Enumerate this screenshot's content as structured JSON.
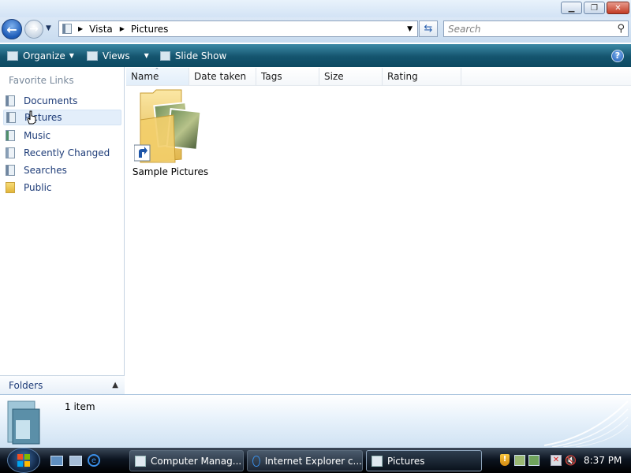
{
  "window": {
    "minimize_glyph": "▁",
    "maximize_glyph": "❐",
    "close_glyph": "✕"
  },
  "address": {
    "segments": [
      "Vista",
      "Pictures"
    ],
    "search_placeholder": "Search"
  },
  "toolbar": {
    "organize_label": "Organize",
    "views_label": "Views",
    "slideshow_label": "Slide Show",
    "help_label": "?"
  },
  "nav": {
    "title": "Favorite Links",
    "items": [
      {
        "label": "Documents",
        "icon": "documents-icon"
      },
      {
        "label": "Pictures",
        "icon": "pictures-icon",
        "selected": true
      },
      {
        "label": "Music",
        "icon": "music-icon"
      },
      {
        "label": "Recently Changed",
        "icon": "recently-changed-icon"
      },
      {
        "label": "Searches",
        "icon": "searches-icon"
      },
      {
        "label": "Public",
        "icon": "public-folder-icon"
      }
    ],
    "folders_label": "Folders"
  },
  "columns": [
    "Name",
    "Date taken",
    "Tags",
    "Size",
    "Rating"
  ],
  "files": [
    {
      "name": "Sample Pictures",
      "icon": "folder-shortcut-icon"
    }
  ],
  "details": {
    "count_text": "1 item"
  },
  "taskbar": {
    "tasks": [
      {
        "label": "Computer Manag...",
        "active": false
      },
      {
        "label": "Internet Explorer c...",
        "active": false
      },
      {
        "label": "Pictures",
        "active": true
      }
    ],
    "clock": "8:37 PM"
  },
  "colors": {
    "toolbar": "#14546e",
    "link_text": "#1e3c78",
    "selection": "#e3eefa"
  }
}
